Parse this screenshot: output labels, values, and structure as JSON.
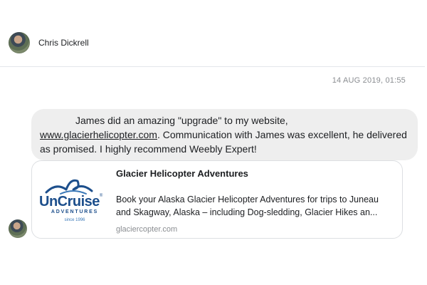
{
  "sender": {
    "name": "Chris Dickrell",
    "avatar_icon": "user-avatar-photo"
  },
  "timestamp": "14 AUG 2019, 01:55",
  "message": {
    "text_before_link": "James did an amazing \"upgrade\" to my website,",
    "link_text": "www.glacierhelicopter.com",
    "text_after_link": ". Communication with James was excellent, he delivered as promised. I highly recommend Weebly Expert!"
  },
  "link_preview": {
    "title": "Glacier Helicopter Adventures",
    "description_line1": "Book your Alaska Glacier Helicopter Adventures for trips to Juneau",
    "description_line2": "and Skagway, Alaska – including Dog-sledding, Glacier Hikes an...",
    "domain": "glaciercopter.com",
    "logo": {
      "word": "UnCruise",
      "tm": "®",
      "subtitle": "ADVENTURES",
      "since": "since 1996"
    }
  },
  "colors": {
    "bubble_bg": "#eeeeee",
    "logo_navy": "#1d4f8c",
    "logo_blue": "#3b79b8",
    "muted_text": "#8a8d91"
  }
}
